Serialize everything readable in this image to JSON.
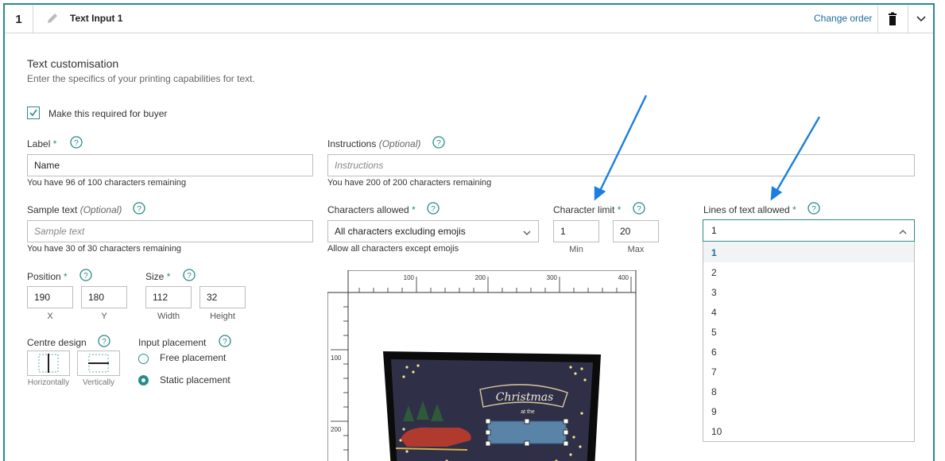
{
  "header": {
    "number": "1",
    "title": "Text Input 1",
    "change_order": "Change order"
  },
  "section": {
    "title": "Text customisation",
    "description": "Enter the specifics of your printing capabilities for text."
  },
  "required_checkbox": {
    "label": "Make this required for buyer",
    "checked": true
  },
  "label_field": {
    "label": "Label",
    "required": "*",
    "value": "Name",
    "hint": "You have 96 of 100 characters remaining"
  },
  "instructions_field": {
    "label": "Instructions",
    "optional": "(Optional)",
    "placeholder": "Instructions",
    "hint": "You have 200 of 200 characters remaining"
  },
  "sample_field": {
    "label": "Sample text",
    "optional": "(Optional)",
    "placeholder": "Sample text",
    "hint": "You have 30 of 30 characters remaining"
  },
  "chars_allowed": {
    "label": "Characters allowed",
    "required": "*",
    "value": "All characters excluding emojis",
    "hint": "Allow all characters except emojis"
  },
  "char_limit": {
    "label": "Character limit",
    "required": "*",
    "min_value": "1",
    "max_value": "20",
    "min_label": "Min",
    "max_label": "Max"
  },
  "lines_allowed": {
    "label": "Lines of text allowed",
    "required": "*",
    "value": "1",
    "options": [
      "1",
      "2",
      "3",
      "4",
      "5",
      "6",
      "7",
      "8",
      "9",
      "10"
    ]
  },
  "position": {
    "label": "Position",
    "required": "*",
    "x": "190",
    "y": "180",
    "x_label": "X",
    "y_label": "Y"
  },
  "size": {
    "label": "Size",
    "required": "*",
    "width": "112",
    "height": "32",
    "width_label": "Width",
    "height_label": "Height"
  },
  "centre_design": {
    "label": "Centre design",
    "horizontal": "Horizontally",
    "vertical": "Vertically"
  },
  "input_placement": {
    "label": "Input placement",
    "free": "Free placement",
    "static": "Static placement",
    "selected": "static"
  },
  "ruler": {
    "top_ticks": [
      "100",
      "200",
      "300",
      "400"
    ],
    "left_ticks": [
      "100",
      "200"
    ]
  },
  "card": {
    "title": "Christmas",
    "subtitle": "at the"
  },
  "colors": {
    "accent": "#2a8a8a",
    "link": "#1a6e9e",
    "arrow": "#1a7fe0",
    "card_bg": "#2f2f48"
  }
}
